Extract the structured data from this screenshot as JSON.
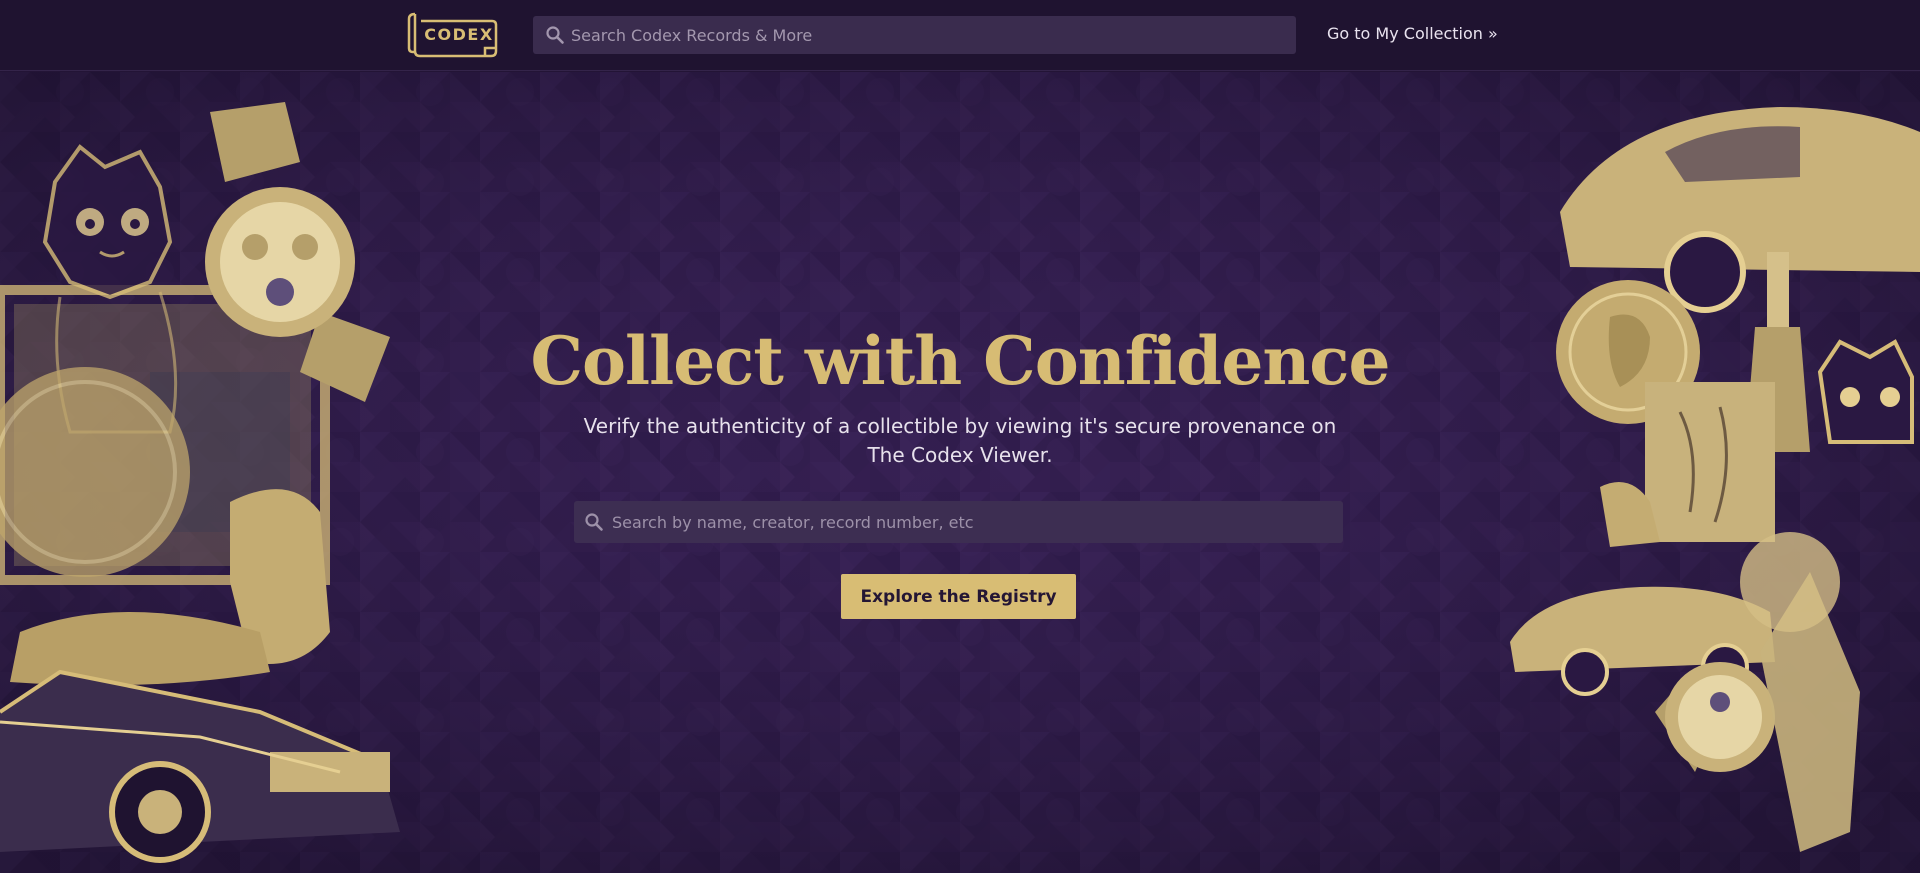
{
  "header": {
    "logo_text": "CODEX",
    "search_placeholder": "Search Codex Records & More",
    "collection_link": "Go to My Collection »"
  },
  "hero": {
    "title": "Collect with Confidence",
    "subtitle": "Verify the authenticity of a collectible by viewing it's secure provenance on The Codex Viewer.",
    "search_placeholder": "Search by name, creator, record number, etc",
    "cta_label": "Explore the Registry"
  },
  "collage": {
    "left_items": [
      "cat-illustration",
      "wristwatch",
      "framed-painting",
      "coin",
      "lounge-chair",
      "classic-car"
    ],
    "right_items": [
      "classic-sports-car",
      "coin",
      "wine-bottle",
      "cat-illustration",
      "sketch-artwork",
      "lounge-chair",
      "classic-sports-car",
      "wristwatch",
      "easel"
    ]
  },
  "colors": {
    "background": "#2a1842",
    "header": "#1f1330",
    "accent_gold": "#d8bd74",
    "search_bg": "#3a2c4e",
    "text_light": "#e7e1ec"
  }
}
